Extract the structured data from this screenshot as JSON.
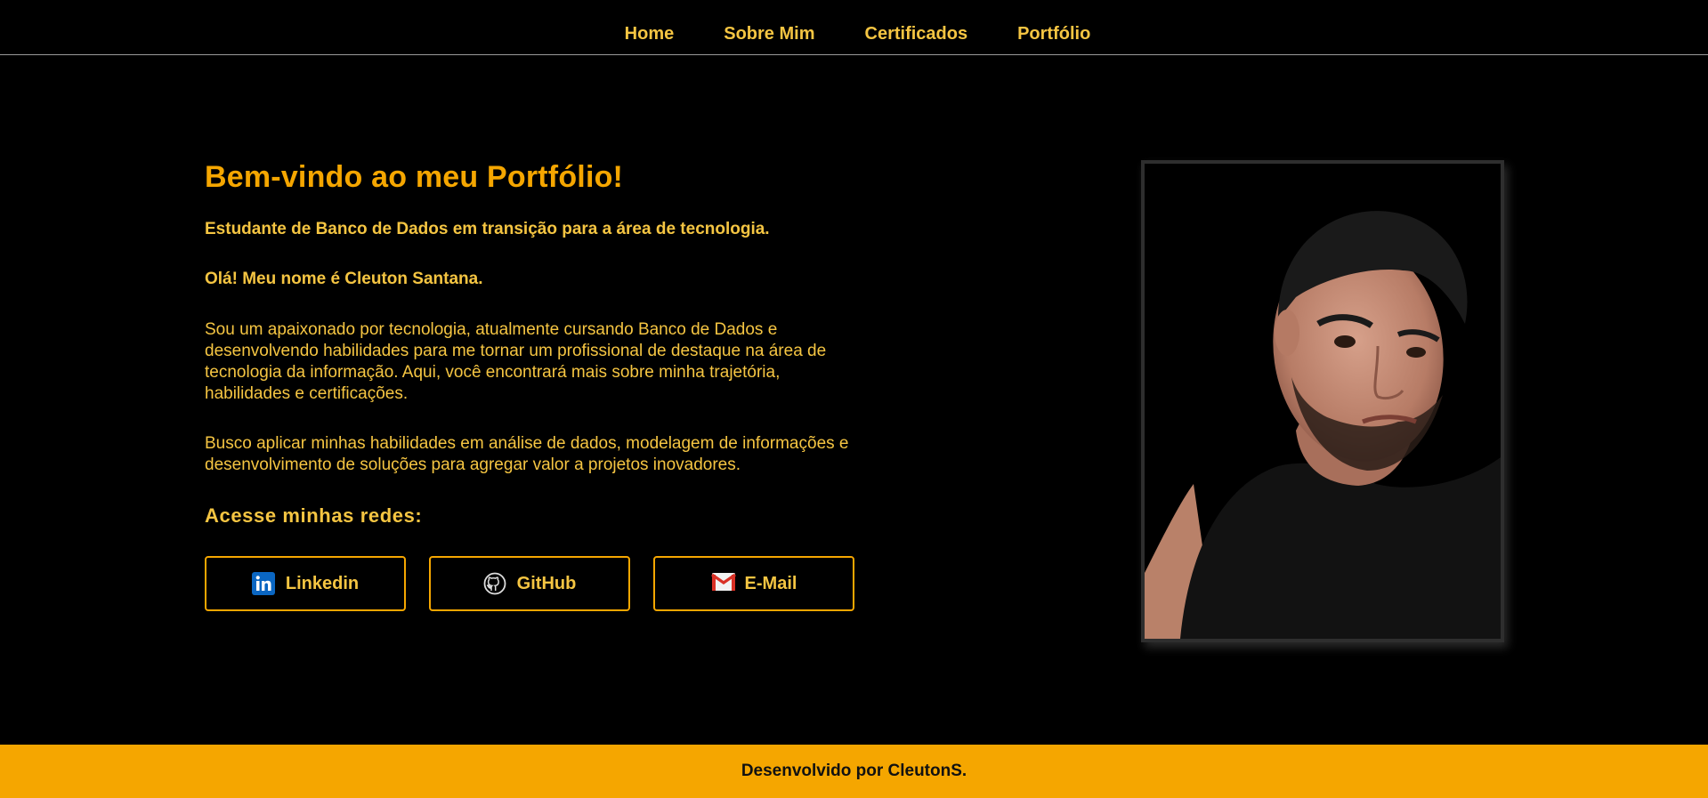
{
  "nav": {
    "items": [
      {
        "label": "Home"
      },
      {
        "label": "Sobre Mim"
      },
      {
        "label": "Certificados"
      },
      {
        "label": "Portfólio"
      }
    ]
  },
  "hero": {
    "title": "Bem-vindo ao meu Portfólio!",
    "subtitle": "Estudante de Banco de Dados em transição para a área de tecnologia.",
    "greeting": "Olá! Meu nome é Cleuton Santana.",
    "paragraph1": "Sou um apaixonado por tecnologia, atualmente cursando Banco de Dados e desenvolvendo habilidades para me tornar um profissional de destaque na área de tecnologia da informação. Aqui, você encontrará mais sobre minha trajetória, habilidades e certificações.",
    "paragraph2": "Busco aplicar minhas habilidades em análise de dados, modelagem de informações e desenvolvimento de soluções para agregar valor a projetos inovadores.",
    "networks_title": "Acesse minhas redes:"
  },
  "buttons": [
    {
      "label": "Linkedin",
      "icon": "linkedin-icon"
    },
    {
      "label": "GitHub",
      "icon": "github-icon"
    },
    {
      "label": "E-Mail",
      "icon": "gmail-icon"
    }
  ],
  "footer": {
    "text": "Desenvolvido por CleutonS."
  },
  "colors": {
    "background": "#000000",
    "accent": "#f5a600",
    "text": "#f5c542",
    "footer_text": "#111111"
  }
}
